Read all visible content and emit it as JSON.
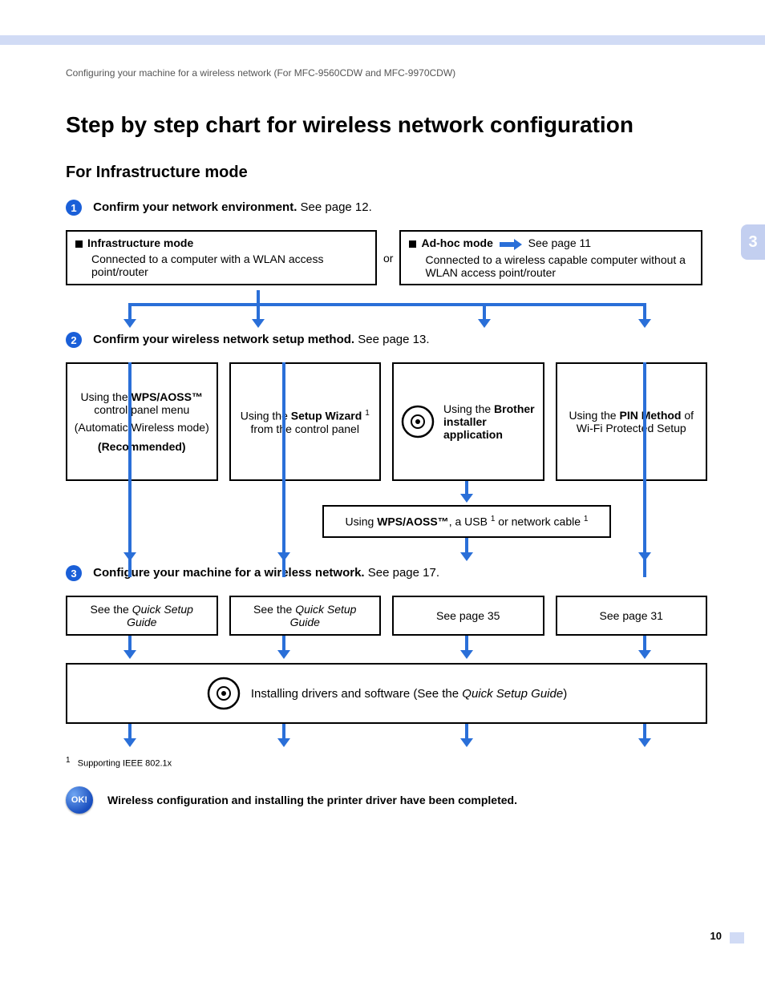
{
  "breadcrumb": "Configuring your machine for a wireless network (For MFC-9560CDW and MFC-9970CDW)",
  "side_tab": "3",
  "h1": "Step by step chart for wireless network configuration",
  "h2": "For Infrastructure mode",
  "step1_num": "1",
  "step1_bold": "Confirm your network environment.",
  "step1_rest": " See page 12.",
  "infra_hdr": "Infrastructure mode",
  "infra_body": "Connected to a computer with a WLAN access point/router",
  "or": "or",
  "adhoc_hdr": "Ad-hoc mode",
  "adhoc_link": " See page 11",
  "adhoc_body": "Connected to a wireless capable computer without a WLAN access point/router",
  "step2_num": "2",
  "step2_bold": "Confirm your wireless network setup method.",
  "step2_rest": " See page 13.",
  "m1_using": "Using the ",
  "m1_bold": "WPS/AOSS™",
  "m1_rest": " control panel menu",
  "m1_paren": "(Automatic Wireless mode)",
  "m1_rec": "(Recommended)",
  "m2_using": "Using the ",
  "m2_bold": "Setup Wizard",
  "m2_sup": "1",
  "m2_rest": " from the control panel",
  "m3_using": "Using the ",
  "m3_bold": "Brother installer application",
  "m4_using": "Using the ",
  "m4_bold": "PIN Method",
  "m4_rest": " of Wi-Fi Protected Setup",
  "mid_using": "Using ",
  "mid_bold": "WPS/AOSS™",
  "mid_rest_a": ", a USB ",
  "mid_sup": "1",
  "mid_rest_b": " or network cable ",
  "step3_num": "3",
  "step3_bold": "Configure your machine for a wireless network.",
  "step3_rest": " See page 17.",
  "r1": "See the ",
  "r1_i": "Quick Setup Guide",
  "r2": "See the ",
  "r2_i": "Quick Setup Guide",
  "r3": "See page 35",
  "r4": "See page 31",
  "install_a": "Installing drivers and software (See the ",
  "install_i": "Quick Setup Guide",
  "install_b": ")",
  "fn_sup": "1",
  "fn_text": "Supporting IEEE 802.1x",
  "ok_label": "OK!",
  "ok_text": "Wireless configuration and installing the printer driver have been completed.",
  "pagenum": "10"
}
